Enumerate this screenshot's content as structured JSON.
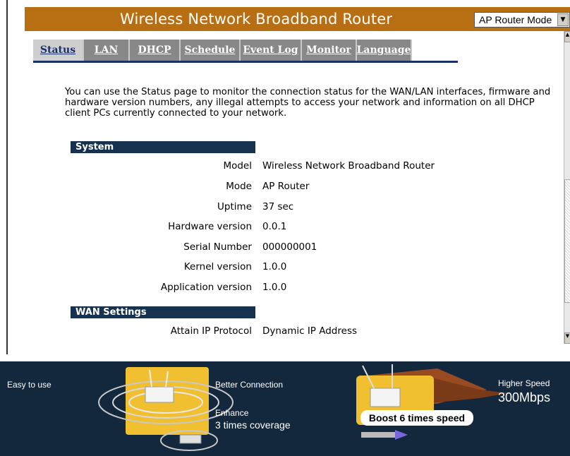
{
  "header": {
    "title": "Wireless Network Broadband Router",
    "mode_select": {
      "value": "AP Router Mode"
    }
  },
  "tabs": [
    {
      "label": "Status",
      "active": true
    },
    {
      "label": "LAN",
      "active": false
    },
    {
      "label": "DHCP",
      "active": false
    },
    {
      "label": "Schedule",
      "active": false
    },
    {
      "label": "Event Log",
      "active": false
    },
    {
      "label": "Monitor",
      "active": false
    },
    {
      "label": "Language",
      "active": false
    }
  ],
  "intro_text": "You can use the Status page to monitor the connection status for the WAN/LAN interfaces, firmware and hardware version numbers, any illegal attempts to access your network and information on all DHCP client PCs currently connected to your network.",
  "system": {
    "heading": "System",
    "rows": [
      {
        "label": "Model",
        "value": "Wireless Network Broadband Router"
      },
      {
        "label": "Mode",
        "value": "AP Router"
      },
      {
        "label": "Uptime",
        "value": "37 sec"
      },
      {
        "label": "Hardware version",
        "value": "0.0.1"
      },
      {
        "label": "Serial Number",
        "value": "000000001"
      },
      {
        "label": "Kernel version",
        "value": "1.0.0"
      },
      {
        "label": "Application version",
        "value": "1.0.0"
      }
    ]
  },
  "wan": {
    "heading": "WAN Settings",
    "rows": [
      {
        "label": "Attain IP Protocol",
        "value": "Dynamic IP Address"
      }
    ]
  },
  "banner": {
    "easy": "Easy to use",
    "better": "Better Connection",
    "enhance": "Enhance",
    "coverage": "3 times coverage",
    "boost": "Boost 6 times speed",
    "higher": "Higher Speed",
    "speed": "300Mbps"
  },
  "colors": {
    "header_bg": "#b86e13",
    "section_bg": "#16324e",
    "tab_bg": "#888888",
    "tab_active_bg": "#cfcfcf",
    "banner_bg": "#13273d"
  }
}
